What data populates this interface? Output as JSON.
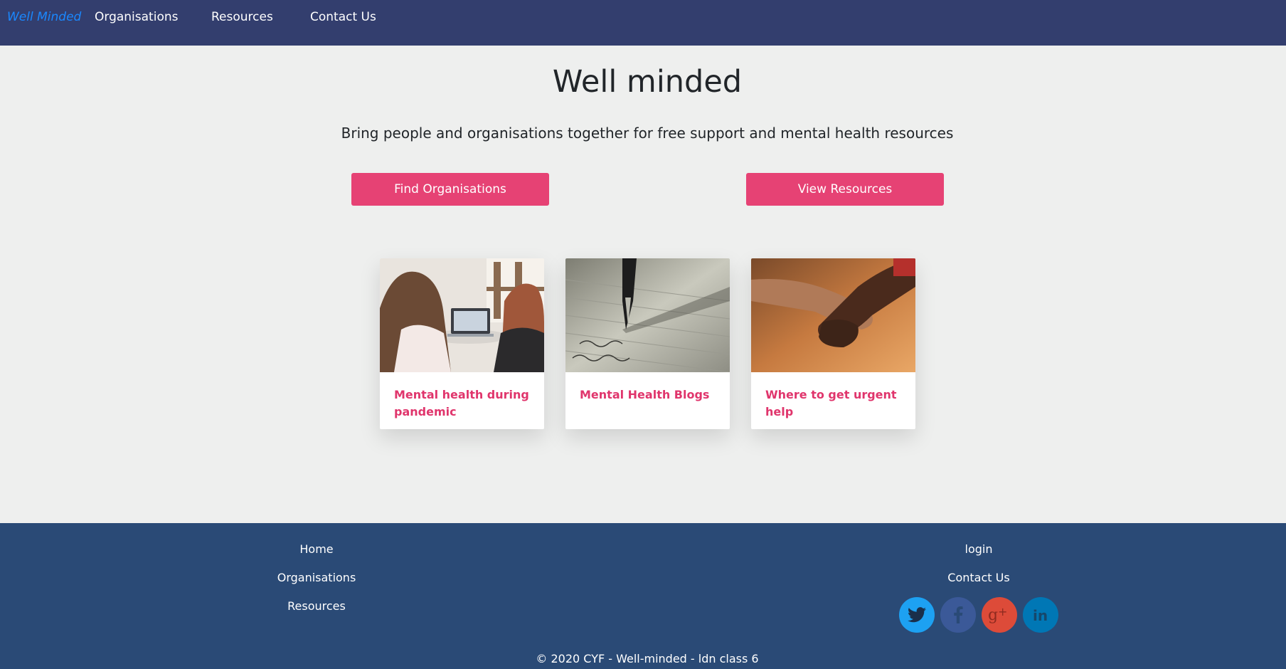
{
  "nav": {
    "brand": "Well Minded",
    "links": [
      "Organisations",
      "Resources",
      "Contact Us"
    ]
  },
  "hero": {
    "title": "Well minded",
    "tagline": "Bring people and organisations together for free support and mental health resources",
    "buttons": [
      "Find Organisations",
      "View Resources"
    ]
  },
  "cards": [
    {
      "title": "Mental health during pandemic",
      "image": "two-women-at-laptop-photo"
    },
    {
      "title": "Mental Health Blogs",
      "image": "fountain-pen-writing-photo"
    },
    {
      "title": "Where to get urgent help",
      "image": "holding-hands-photo"
    }
  ],
  "footer": {
    "left_links": [
      "Home",
      "Organisations",
      "Resources"
    ],
    "right_links": [
      "login",
      "Contact Us"
    ],
    "social": [
      {
        "name": "twitter-icon",
        "color": "#1da1f2"
      },
      {
        "name": "facebook-icon",
        "color": "#3b5998"
      },
      {
        "name": "google-plus-icon",
        "color": "#dd4b39"
      },
      {
        "name": "linkedin-icon",
        "color": "#0077b5"
      }
    ],
    "copyright": "© 2020 CYF - Well-minded - ldn class 6"
  },
  "colors": {
    "nav_bg": "#333e6e",
    "brand": "#1a88ff",
    "accent": "#e64274",
    "footer_bg": "#2a4a76"
  }
}
